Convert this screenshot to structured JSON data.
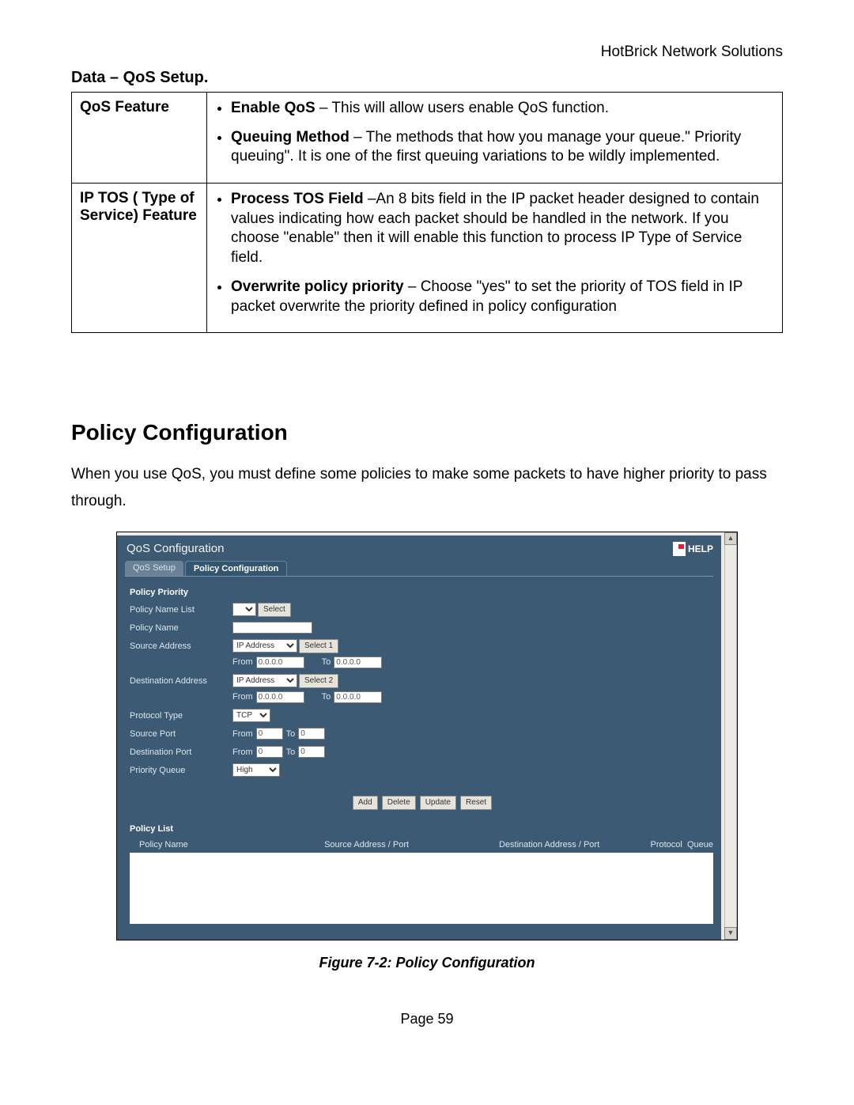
{
  "header": {
    "company": "HotBrick Network Solutions"
  },
  "section": {
    "title": "Data – QoS Setup."
  },
  "table": {
    "row1": {
      "label": "QoS Feature",
      "b1_bold": "Enable QoS",
      "b1_rest": " – This will allow users enable QoS function.",
      "b2_bold": "Queuing Method",
      "b2_rest": " – The methods that how you manage your queue.\" Priority queuing\". It is one of the first queuing variations to be wildly implemented."
    },
    "row2": {
      "label": "IP TOS ( Type of Service) Feature",
      "b1_bold": "Process TOS Field",
      "b1_rest": " –An 8 bits field in the IP packet header designed to contain values indicating how each packet should be handled in the network. If you choose \"enable\" then it will enable this function to process IP Type of Service field.",
      "b2_bold": "Overwrite policy priority",
      "b2_rest": " – Choose \"yes\" to set the priority of TOS field in IP packet overwrite the priority defined in policy configuration"
    }
  },
  "heading": "Policy Configuration",
  "body": "When you use QoS, you must define some policies to make some packets to have higher priority to pass through.",
  "ui": {
    "title": "QoS Configuration",
    "help": "HELP",
    "tabs": {
      "inactive": "QoS Setup",
      "active": "Policy Configuration"
    },
    "sec1": "Policy Priority",
    "labels": {
      "policy_name_list": "Policy Name List",
      "policy_name": "Policy Name",
      "source_address": "Source Address",
      "dest_address": "Destination Address",
      "protocol_type": "Protocol Type",
      "source_port": "Source Port",
      "dest_port": "Destination Port",
      "priority_queue": "Priority Queue"
    },
    "buttons": {
      "select": "Select",
      "select1": "Select 1",
      "select2": "Select 2",
      "add": "Add",
      "delete": "Delete",
      "update": "Update",
      "reset": "Reset"
    },
    "text": {
      "from": "From",
      "to": "To"
    },
    "values": {
      "ipaddress": "IP Address",
      "ip0": "0.0.0.0",
      "zero": "0",
      "tcp": "TCP",
      "high": "High"
    },
    "sec2": "Policy List",
    "cols": {
      "name": "Policy Name",
      "src": "Source Address / Port",
      "dst": "Destination Address / Port",
      "proto": "Protocol",
      "queue": "Queue"
    }
  },
  "caption": "Figure 7-2: Policy Configuration",
  "page": "Page 59"
}
